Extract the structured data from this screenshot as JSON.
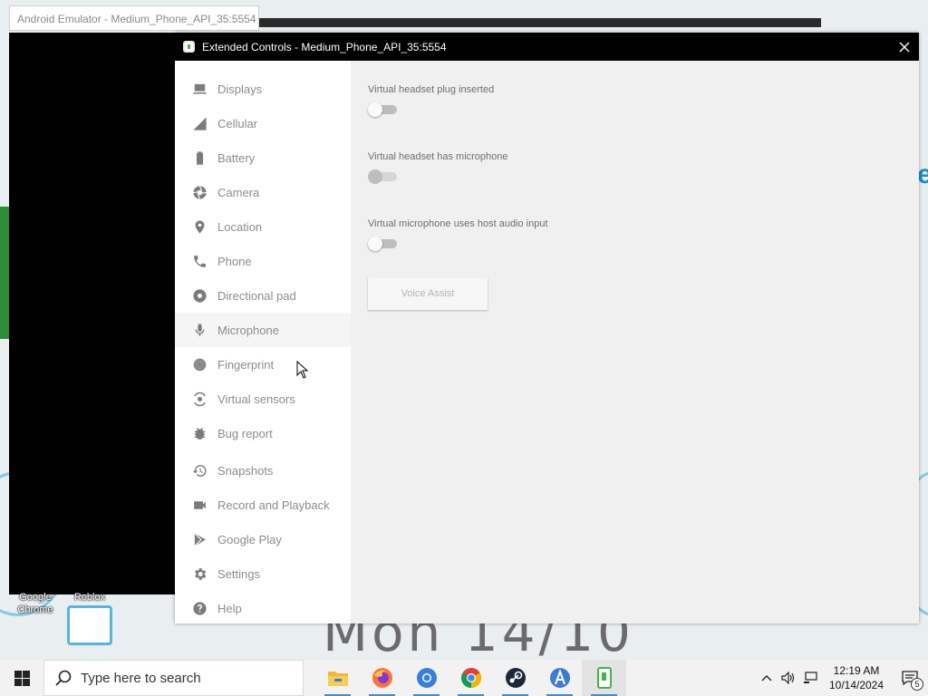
{
  "emulator": {
    "window_title": "Android Emulator - Medium_Phone_API_35:5554"
  },
  "desktop": {
    "wallpaper_text": "Mon 14/10",
    "icons": [
      {
        "label": "Google\nChrome"
      },
      {
        "label": "Roblox"
      }
    ]
  },
  "extended_controls": {
    "title": "Extended Controls - Medium_Phone_API_35:5554",
    "nav": [
      {
        "label": "Displays",
        "icon": "display-icon"
      },
      {
        "label": "Cellular",
        "icon": "cellular-icon"
      },
      {
        "label": "Battery",
        "icon": "battery-icon"
      },
      {
        "label": "Camera",
        "icon": "camera-icon"
      },
      {
        "label": "Location",
        "icon": "location-icon"
      },
      {
        "label": "Phone",
        "icon": "phone-icon"
      },
      {
        "label": "Directional pad",
        "icon": "dpad-icon"
      },
      {
        "label": "Microphone",
        "icon": "microphone-icon",
        "active": true
      },
      {
        "label": "Fingerprint",
        "icon": "fingerprint-icon"
      },
      {
        "label": "Virtual sensors",
        "icon": "sensors-icon"
      },
      {
        "label": "Bug report",
        "icon": "bug-icon"
      },
      {
        "label": "Snapshots",
        "icon": "history-icon"
      },
      {
        "label": "Record and Playback",
        "icon": "videocam-icon"
      },
      {
        "label": "Google Play",
        "icon": "play-icon"
      },
      {
        "label": "Settings",
        "icon": "gear-icon"
      },
      {
        "label": "Help",
        "icon": "help-icon"
      }
    ],
    "microphone": {
      "settings": [
        {
          "label": "Virtual headset plug inserted",
          "on": false,
          "enabled": true
        },
        {
          "label": "Virtual headset has microphone",
          "on": false,
          "enabled": false
        },
        {
          "label": "Virtual microphone uses host audio input",
          "on": false,
          "enabled": true
        }
      ],
      "voice_assist_label": "Voice Assist"
    }
  },
  "taskbar": {
    "search_placeholder": "Type here to search",
    "apps": [
      {
        "name": "file-explorer-icon",
        "color": "#f2b632"
      },
      {
        "name": "firefox-icon",
        "color": "#ff7139"
      },
      {
        "name": "chromium-icon",
        "color": "#3b7ddd"
      },
      {
        "name": "chrome-icon",
        "color": "#db4437"
      },
      {
        "name": "steam-icon",
        "color": "#1b2838"
      },
      {
        "name": "android-studio-icon",
        "color": "#3c7bd6"
      },
      {
        "name": "emulator-icon",
        "color": "#4caf50",
        "active": true
      }
    ],
    "time": "12:19 AM",
    "date": "10/14/2024",
    "notification_count": "5"
  },
  "colors": {
    "titlebar": "#000000",
    "sidebar_bg": "#ffffff",
    "content_bg": "#f0f0f0",
    "nav_text": "#8c8c8c",
    "taskbar_bg": "#f2f2f2"
  }
}
